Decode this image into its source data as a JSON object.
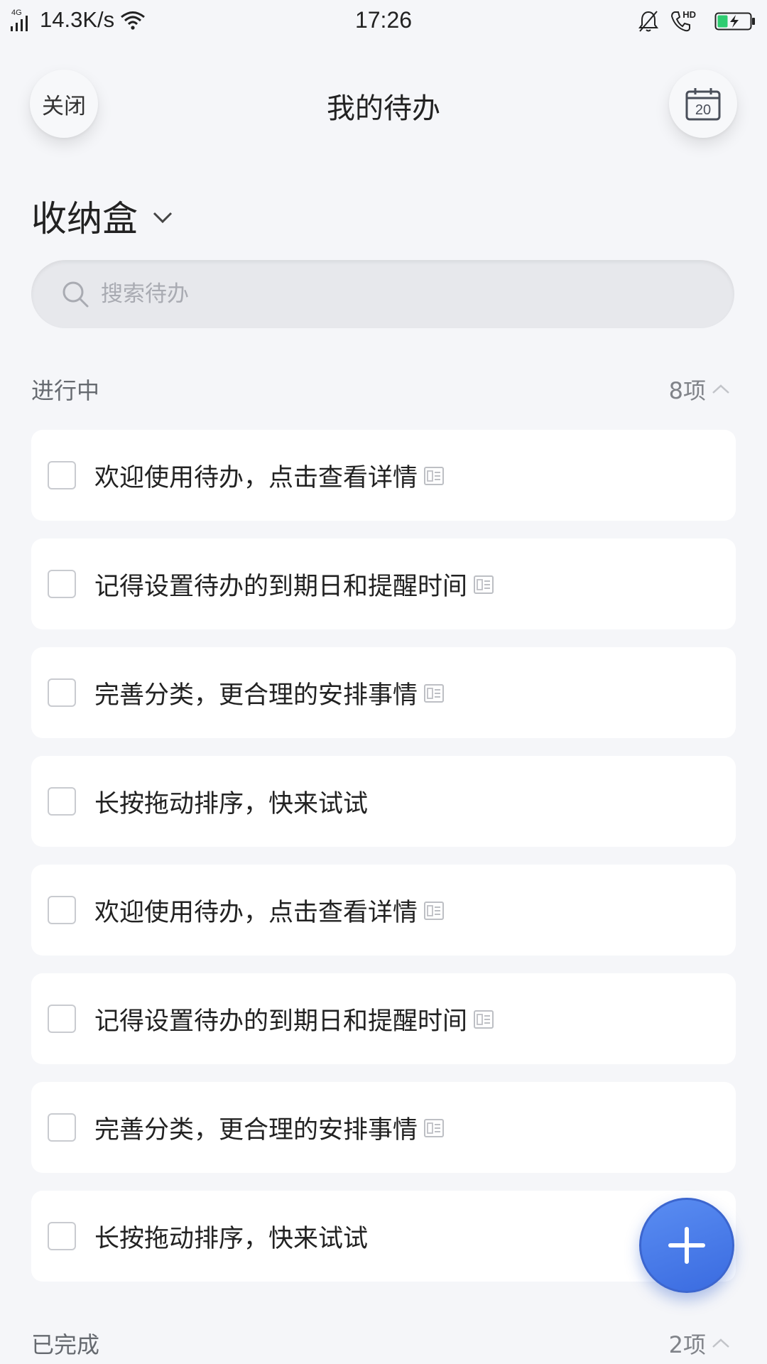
{
  "status_bar": {
    "network_type": "4G",
    "speed": "14.3K/s",
    "time": "17:26",
    "call_badge": "HD",
    "battery_color": "#2ecc71"
  },
  "header": {
    "close_label": "关闭",
    "title": "我的待办",
    "calendar_day": "20"
  },
  "category": {
    "title": "收纳盒"
  },
  "search": {
    "placeholder": "搜索待办",
    "value": ""
  },
  "in_progress": {
    "label": "进行中",
    "count": "8项",
    "items": [
      {
        "text": "欢迎使用待办，点击查看详情",
        "has_note": true
      },
      {
        "text": "记得设置待办的到期日和提醒时间",
        "has_note": true
      },
      {
        "text": "完善分类，更合理的安排事情",
        "has_note": true
      },
      {
        "text": "长按拖动排序，快来试试",
        "has_note": false
      },
      {
        "text": "欢迎使用待办，点击查看详情",
        "has_note": true
      },
      {
        "text": "记得设置待办的到期日和提醒时间",
        "has_note": true
      },
      {
        "text": "完善分类，更合理的安排事情",
        "has_note": true
      },
      {
        "text": "长按拖动排序，快来试试",
        "has_note": false
      }
    ]
  },
  "completed": {
    "label": "已完成",
    "count": "2项"
  },
  "icons": {
    "fab": "plus-icon",
    "collapse": "chevron-up-icon",
    "category_dropdown": "chevron-down-icon",
    "note": "note-icon"
  },
  "colors": {
    "background": "#f5f6f9",
    "card": "#ffffff",
    "accent": "#4a7eea",
    "search_bg": "#e7e8ec"
  }
}
